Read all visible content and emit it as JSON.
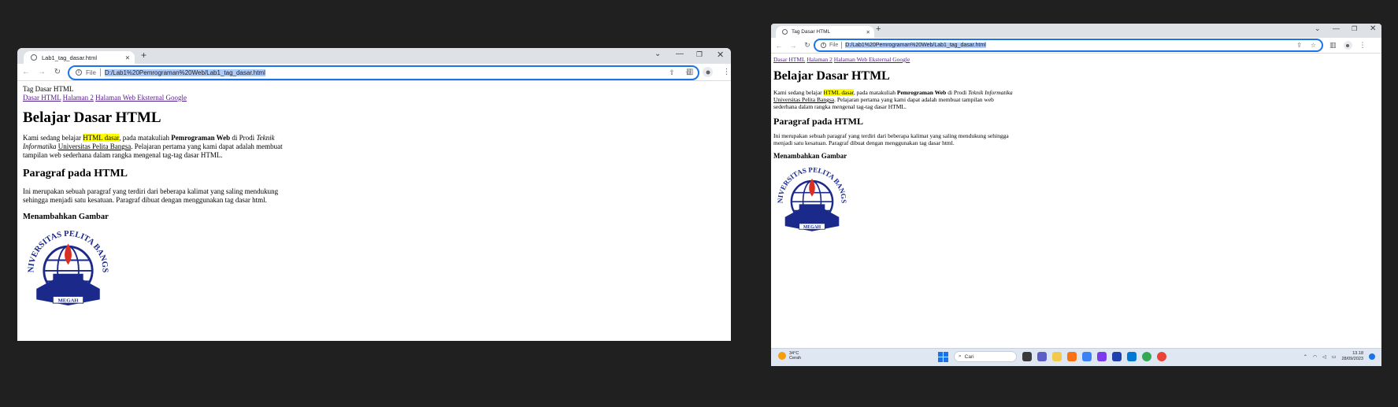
{
  "left_window": {
    "tab_title": "Lab1_tag_dasar.html",
    "file_label": "File",
    "url": "D:/Lab1%20Pemrograman%20Web/Lab1_tag_dasar.html",
    "page": {
      "title_text": "Tag Dasar HTML",
      "nav": [
        "Dasar HTML",
        "Halaman 2",
        "Halaman Web Eksternal Google"
      ],
      "h1": "Belajar Dasar HTML",
      "p1": {
        "a": "Kami sedang belajar ",
        "highlight": "HTML dasar",
        "b": ", pada matakuliah ",
        "bold": "Pemrograman Web",
        "c": " di Prodi ",
        "italic": "Teknik Informatika",
        "d": " ",
        "underline": "Universitas Pelita Bangsa",
        "e": ". Pelajaran pertama yang kami dapat adalah membuat tampilan web sederhana dalam rangka mengenal tag-tag dasar HTML."
      },
      "h2": "Paragraf pada HTML",
      "p2": "Ini merupakan sebuah paragraf yang terdiri dari beberapa kalimat yang saling mendukung sehingga menjadi satu kesatuan. Paragraf dibuat dengan menggunakan tag dasar html.",
      "h3": "Menambahkan Gambar"
    }
  },
  "right_window": {
    "tab_title": "Tag Dasar HTML",
    "file_label": "File",
    "url": "D:/Lab1%20Pemrograman%20Web/Lab1_tag_dasar.html",
    "page": {
      "nav": [
        "Dasar HTML",
        "Halaman 2",
        "Halaman Web Eksternal Google"
      ],
      "h1": "Belajar Dasar HTML",
      "p1": {
        "a": "Kami sedang belajar ",
        "highlight": "HTML dasar",
        "b": ", pada matakuliah ",
        "bold": "Pemrograman Web",
        "c": " di Prodi ",
        "italic": "Teknik Informatika",
        "d": " ",
        "underline": "Universitas Pelita Bangsa",
        "e": ". Pelajaran pertama yang kami dapat adalah membuat tampilan web sederhana dalam rangka mengenal tag-tag dasar HTML."
      },
      "h2": "Paragraf pada HTML",
      "p2": "Ini merupakan sebuah paragraf yang terdiri dari beberapa kalimat yang saling mendukung sehingga menjadi satu kesatuan. Paragraf dibuat dengan menggunakan tag dasar html.",
      "h3": "Menambahkan Gambar"
    }
  },
  "logo": {
    "ring_text": "UNIVERSITAS PELITA BANGSA",
    "banner_text": "MEGAH",
    "color": "#1b2a8a",
    "flame_color": "#d93025"
  },
  "taskbar": {
    "temperature": "34°C",
    "weather": "Cerah",
    "search_label": "Cari",
    "time": "13.18",
    "date": "28/09/2023"
  },
  "colors": {
    "desktop": "#202020",
    "tabstrip": "#dee1e6",
    "focus_ring": "#1a73e8",
    "url_selection": "#aecbfa",
    "highlight": "#ffff00",
    "link_visited": "#551a8b"
  }
}
